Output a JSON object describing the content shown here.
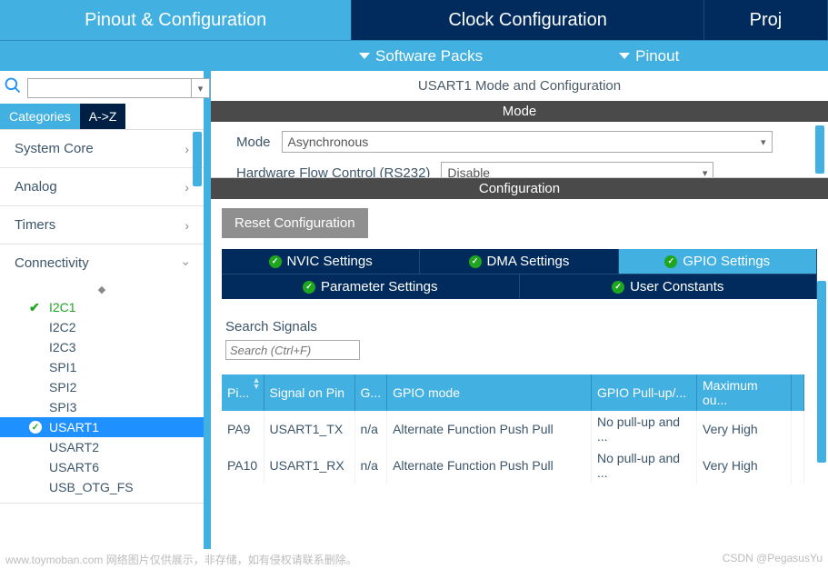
{
  "top_tabs": {
    "pinout": "Pinout & Configuration",
    "clock": "Clock Configuration",
    "project": "Proj"
  },
  "sub_bar": {
    "software_packs": "Software Packs",
    "pinout": "Pinout"
  },
  "left": {
    "cat_tab": "Categories",
    "az_tab": "A->Z",
    "groups": {
      "system_core": "System Core",
      "analog": "Analog",
      "timers": "Timers",
      "connectivity": "Connectivity"
    },
    "conn_items": [
      "I2C1",
      "I2C2",
      "I2C3",
      "SPI1",
      "SPI2",
      "SPI3",
      "USART1",
      "USART2",
      "USART6",
      "USB_OTG_FS"
    ]
  },
  "panel": {
    "title": "USART1 Mode and Configuration",
    "mode_head": "Mode",
    "mode_label": "Mode",
    "mode_value": "Asynchronous",
    "hw_label": "Hardware Flow Control (RS232)",
    "hw_value": "Disable",
    "config_head": "Configuration",
    "reset_btn": "Reset Configuration",
    "tabs": {
      "nvic": "NVIC Settings",
      "dma": "DMA Settings",
      "gpio": "GPIO Settings",
      "param": "Parameter Settings",
      "user": "User Constants"
    },
    "search_signals_label": "Search Signals",
    "search_placeholder": "Search (Ctrl+F)",
    "table": {
      "headers": {
        "pin": "Pi...",
        "signal": "Signal on Pin",
        "gpio_out": "G...",
        "mode": "GPIO mode",
        "pull": "GPIO Pull-up/...",
        "speed": "Maximum ou..."
      },
      "rows": [
        {
          "pin": "PA9",
          "signal": "USART1_TX",
          "out": "n/a",
          "mode": "Alternate Function Push Pull",
          "pull": "No pull-up and ...",
          "speed": "Very High"
        },
        {
          "pin": "PA10",
          "signal": "USART1_RX",
          "out": "n/a",
          "mode": "Alternate Function Push Pull",
          "pull": "No pull-up and ...",
          "speed": "Very High"
        }
      ]
    }
  },
  "footer": {
    "left": "www.toymoban.com 网络图片仅供展示，非存储，如有侵权请联系删除。",
    "right": "CSDN @PegasusYu"
  }
}
